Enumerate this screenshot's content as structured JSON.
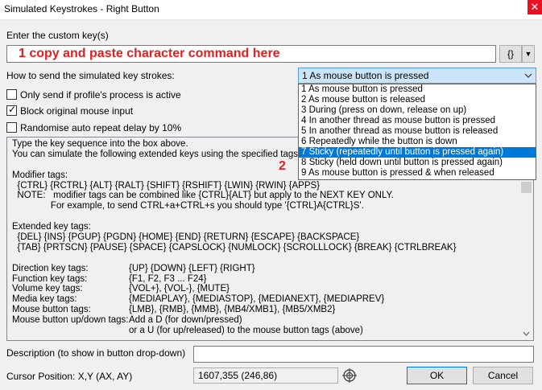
{
  "window": {
    "title": "Simulated Keystrokes - Right Button",
    "close_glyph": "✕"
  },
  "custom_key": {
    "label": "Enter the custom key(s)",
    "value": "1    copy and paste character command here",
    "brace_button": "{}",
    "brace_dropdown_glyph": "▼"
  },
  "send_mode": {
    "label": "How to send the simulated key strokes:",
    "selected": "1 As mouse button is pressed",
    "options": [
      "1 As mouse button is pressed",
      "2 As mouse button is released",
      "3 During (press on down, release on up)",
      "4 In another thread as mouse button is pressed",
      "5 In another thread as mouse button is released",
      "6 Repeatedly while the button is down",
      "7 Sticky (repeatedly until button is pressed again)",
      "8 Sticky (held down until button is pressed again)",
      "9 As mouse button is pressed & when released"
    ],
    "highlighted_index": 6
  },
  "options": {
    "only_send_if_active": {
      "label": "Only send if profile's process is active",
      "checked": false
    },
    "block_original": {
      "label": "Block original mouse input",
      "checked": true
    },
    "randomise_delay": {
      "label": "Randomise auto repeat delay by 10%",
      "checked": false
    }
  },
  "help": {
    "intro1": "Type the key sequence into the box above.",
    "intro2": "You can simulate the following extended keys using the specified tags...",
    "modifier_heading": "Modifier tags:",
    "modifier_tags": "  {CTRL} {RCTRL} {ALT} {RALT} {SHIFT} {RSHIFT} {LWIN} {RWIN} {APPS}",
    "note1": "  NOTE:   modifier tags can be combined like {CTRL}{ALT} but apply to the NEXT KEY ONLY.",
    "note2": "               For example, to send CTRL+a+CTRL+s you should type '{CTRL}A{CTRL}S'.",
    "extended_heading": "Extended key tags:",
    "extended1": "  {DEL} {INS} {PGUP} {PGDN} {HOME} {END} {RETURN} {ESCAPE} {BACKSPACE}",
    "extended2": "  {TAB} {PRTSCN} {PAUSE} {SPACE} {CAPSLOCK} {NUMLOCK} {SCROLLLOCK} {BREAK} {CTRLBREAK}",
    "rows": [
      {
        "name": "Direction key tags:",
        "value": "{UP} {DOWN} {LEFT} {RIGHT}"
      },
      {
        "name": "Function key tags:",
        "value": "{F1, F2, F3 ... F24}"
      },
      {
        "name": "Volume key tags:",
        "value": "{VOL+}, {VOL-}, {MUTE}"
      },
      {
        "name": "Media key tags:",
        "value": "{MEDIAPLAY}, {MEDIASTOP}, {MEDIANEXT}, {MEDIAPREV}"
      },
      {
        "name": "Mouse button tags:",
        "value": "{LMB}, {RMB}, {MMB}, {MB4/XMB1}, {MB5/XMB2}"
      },
      {
        "name": "Mouse button up/down tags:",
        "value": "Add a D (for down/pressed)"
      },
      {
        "name": "",
        "value": "or a U (for up/released) to the mouse button tags (above)"
      }
    ],
    "marker": "2"
  },
  "description": {
    "label": "Description (to show in button drop-down)",
    "value": ""
  },
  "cursor": {
    "label": "Cursor Position: X,Y (AX, AY)",
    "value": "1607,355 (246,86)"
  },
  "buttons": {
    "ok": "OK",
    "cancel": "Cancel"
  },
  "colors": {
    "annotation": "#e02020",
    "selection": "#0078d7",
    "combo_bg": "#cce4f7"
  }
}
